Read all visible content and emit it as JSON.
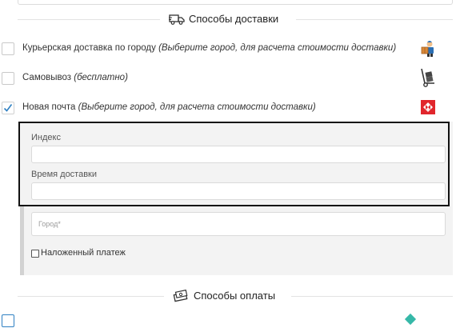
{
  "delivery": {
    "title": "Способы доставки",
    "header_icon": "truck-icon",
    "options": [
      {
        "label": "Курьерская доставка по городу",
        "hint": "(Выберите город, для расчета стоимости доставки)",
        "checked": false,
        "icon": "courier-icon"
      },
      {
        "label": "Самовывоз",
        "hint": "(бесплатно)",
        "checked": false,
        "icon": "hand-truck-icon"
      },
      {
        "label": "Новая почта",
        "hint": "(Выберите город, для расчета стоимости доставки)",
        "checked": true,
        "icon": "nova-poshta-logo-icon"
      }
    ]
  },
  "nova_poshta_form": {
    "index_label": "Индекс",
    "index_value": "",
    "time_label": "Время доставки",
    "time_value": "",
    "city_placeholder": "Город*",
    "city_value": "",
    "cod_label": "Наложенный платеж",
    "cod_checked": false
  },
  "payment": {
    "title": "Способы оплаты",
    "header_icon": "cash-icon"
  },
  "colors": {
    "checkmark": "#2f80c2",
    "nova_poshta_red": "#e1262c",
    "highlight_border": "#111111",
    "panel_bg": "#f3f3f3"
  }
}
